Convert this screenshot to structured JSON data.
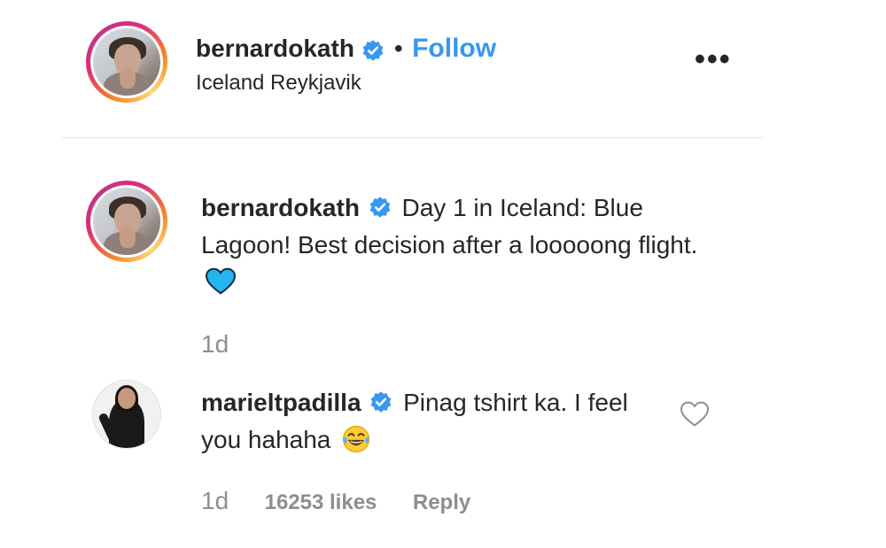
{
  "header": {
    "username": "bernardokath",
    "verified_icon": "verified-badge-icon",
    "separator": "•",
    "follow_label": "Follow",
    "location": "Iceland Reykjavik",
    "more_label": "•••"
  },
  "caption": {
    "username": "bernardokath",
    "text": "Day 1 in Iceland: Blue Lagoon! Best decision after a looooong flight.",
    "emoji": "blue-heart-icon",
    "timestamp": "1d"
  },
  "comment": {
    "username": "marieltpadilla",
    "text": "Pinag tshirt ka. I feel you hahaha",
    "emoji": "tears-of-joy-icon",
    "timestamp": "1d",
    "likes": "16253 likes",
    "reply_label": "Reply",
    "like_icon": "heart-outline-icon"
  },
  "colors": {
    "follow": "#3897f0",
    "verified": "#3897f0",
    "muted": "#8e8e8e",
    "text": "#262626"
  }
}
